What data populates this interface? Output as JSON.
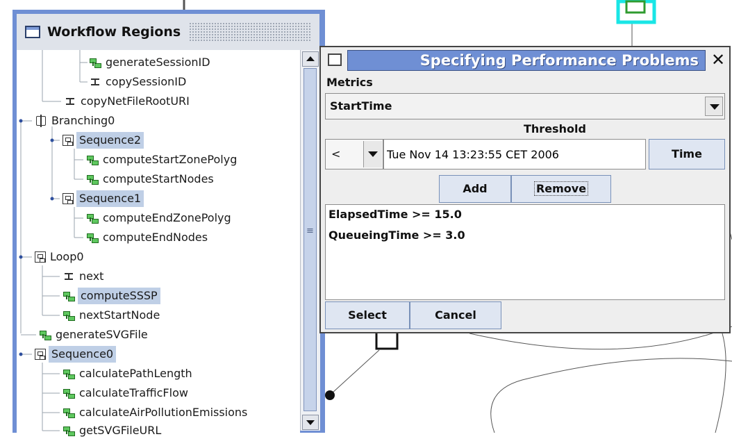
{
  "workflow_regions": {
    "title": "Workflow Regions",
    "tree": [
      {
        "label": "generateSessionID",
        "icon": "task-icon",
        "selected": false
      },
      {
        "label": "copySessionID",
        "icon": "activity-icon",
        "selected": false
      },
      {
        "label": "copyNetFileRootURI",
        "icon": "activity-icon",
        "selected": false
      },
      {
        "label": "Branching0",
        "icon": "branching-icon",
        "selected": false
      },
      {
        "label": "Sequence2",
        "icon": "sequence-icon",
        "selected": true
      },
      {
        "label": "computeStartZonePolyg",
        "icon": "task-icon",
        "selected": false
      },
      {
        "label": "computeStartNodes",
        "icon": "task-icon",
        "selected": false
      },
      {
        "label": "Sequence1",
        "icon": "sequence-icon",
        "selected": true
      },
      {
        "label": "computeEndZonePolyg",
        "icon": "task-icon",
        "selected": false
      },
      {
        "label": "computeEndNodes",
        "icon": "task-icon",
        "selected": false
      },
      {
        "label": "Loop0",
        "icon": "loop-icon",
        "selected": false
      },
      {
        "label": "next",
        "icon": "activity-icon",
        "selected": false
      },
      {
        "label": "computeSSSP",
        "icon": "task-icon",
        "selected": true
      },
      {
        "label": "nextStartNode",
        "icon": "task-icon",
        "selected": false
      },
      {
        "label": "generateSVGFile",
        "icon": "task-icon",
        "selected": false
      },
      {
        "label": "Sequence0",
        "icon": "sequence-icon",
        "selected": true
      },
      {
        "label": "calculatePathLength",
        "icon": "task-icon",
        "selected": false
      },
      {
        "label": "calculateTrafficFlow",
        "icon": "task-icon",
        "selected": false
      },
      {
        "label": "calculateAirPollutionEmissions",
        "icon": "task-icon",
        "selected": false
      },
      {
        "label": "getSVGFileURL",
        "icon": "task-icon",
        "selected": false
      }
    ]
  },
  "dialog": {
    "title": "Specifying Performance Problems",
    "close_label": "✕",
    "metrics_label": "Metrics",
    "metric_selected": "StartTime",
    "threshold_label": "Threshold",
    "operator": "<",
    "time_value": "Tue Nov 14 13:23:55 CET 2006",
    "time_button": "Time",
    "add_button": "Add",
    "remove_button": "Remove",
    "problems": [
      "ElapsedTime >= 15.0",
      "QueueingTime >= 3.0"
    ],
    "select_button": "Select",
    "cancel_button": "Cancel"
  },
  "colors": {
    "panel_frame": "#6f8fd4",
    "selection": "#bfcfe6",
    "highlight_box": "#19e6e6"
  }
}
